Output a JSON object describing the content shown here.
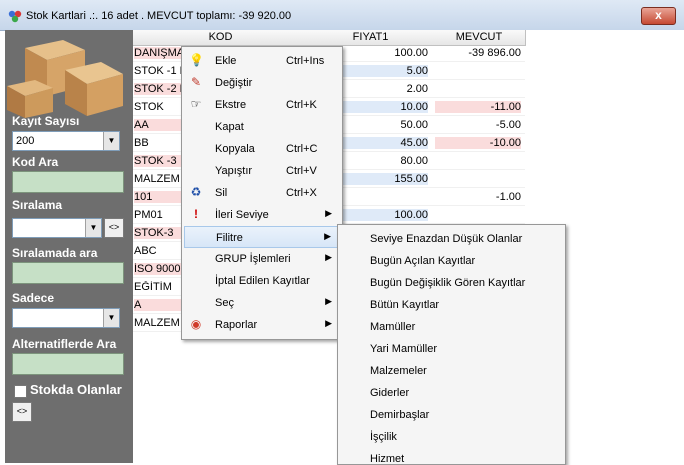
{
  "window": {
    "title": "Stok Kartlari   .:.  16 adet . MEVCUT toplamı: -39 920.00",
    "close_label": "x"
  },
  "left": {
    "kayit_label": "Kayıt Sayısı",
    "kayit_value": "200",
    "kod_ara_label": "Kod Ara",
    "siralama_label": "Sıralama",
    "siralamada_ara_label": "Sıralamada ara",
    "sadece_label": "Sadece",
    "alternatif_label": "Alternatiflerde Ara",
    "stokda_label": "Stokda Olanlar",
    "swap_button": "<>"
  },
  "grid": {
    "columns": [
      "KOD",
      "FIYAT1",
      "MEVCUT"
    ],
    "rows": [
      {
        "kod": "DANIŞMA",
        "fiyat": "100.00",
        "mevcut": "-39 896.00"
      },
      {
        "kod": "STOK -1 D",
        "fiyat": "5.00",
        "mevcut": ""
      },
      {
        "kod": "STOK -2 D",
        "fiyat": "2.00",
        "mevcut": ""
      },
      {
        "kod": "STOK",
        "fiyat": "10.00",
        "mevcut": "-11.00"
      },
      {
        "kod": "AA",
        "fiyat": "50.00",
        "mevcut": "-5.00"
      },
      {
        "kod": "BB",
        "fiyat": "45.00",
        "mevcut": "-10.00"
      },
      {
        "kod": "STOK -3",
        "fiyat": "80.00",
        "mevcut": ""
      },
      {
        "kod": "MALZEM",
        "fiyat": "155.00",
        "mevcut": ""
      },
      {
        "kod": "101",
        "fiyat": "",
        "mevcut": "-1.00"
      },
      {
        "kod": "PM01",
        "fiyat": "100.00",
        "mevcut": ""
      },
      {
        "kod": "STOK-3",
        "fiyat": "",
        "mevcut": ""
      },
      {
        "kod": "ABC",
        "fiyat": "",
        "mevcut": ""
      },
      {
        "kod": "İSO 9000",
        "fiyat": "",
        "mevcut": ""
      },
      {
        "kod": "EĞİTİM",
        "fiyat": "",
        "mevcut": ""
      },
      {
        "kod": "A",
        "fiyat": "",
        "mevcut": ""
      },
      {
        "kod": "MALZEM",
        "fiyat": "",
        "mevcut": ""
      }
    ]
  },
  "context_menu": [
    {
      "label": "Ekle",
      "shortcut": "Ctrl+Ins",
      "icon": "bulb-icon",
      "submenu": false
    },
    {
      "label": "Değiştir",
      "shortcut": "",
      "icon": "pencil-icon",
      "submenu": false
    },
    {
      "label": "Ekstre",
      "shortcut": "Ctrl+K",
      "icon": "hand-icon",
      "submenu": false
    },
    {
      "label": "Kapat",
      "shortcut": "",
      "icon": "",
      "submenu": false
    },
    {
      "label": "Kopyala",
      "shortcut": "Ctrl+C",
      "icon": "",
      "submenu": false
    },
    {
      "label": "Yapıştır",
      "shortcut": "Ctrl+V",
      "icon": "",
      "submenu": false
    },
    {
      "label": "Sil",
      "shortcut": "Ctrl+X",
      "icon": "recycle-icon",
      "submenu": false
    },
    {
      "label": "İleri Seviye",
      "shortcut": "",
      "icon": "exclamation-icon",
      "submenu": true
    },
    {
      "label": "Filitre",
      "shortcut": "",
      "icon": "",
      "submenu": true
    },
    {
      "label": "GRUP İşlemleri",
      "shortcut": "",
      "icon": "",
      "submenu": true
    },
    {
      "label": "İptal Edilen Kayıtlar",
      "shortcut": "",
      "icon": "",
      "submenu": false
    },
    {
      "label": "Seç",
      "shortcut": "",
      "icon": "",
      "submenu": true
    },
    {
      "label": "Raporlar",
      "shortcut": "",
      "icon": "report-icon",
      "submenu": true
    }
  ],
  "filter_submenu": [
    "Seviye Enazdan Düşük Olanlar",
    "Bugün Açılan Kayıtlar",
    "Bugün Değişiklik Gören Kayıtlar",
    "Bütün Kayıtlar",
    "Mamüller",
    "Yari Mamüller",
    "Malzemeler",
    "Giderler",
    "Demirbaşlar",
    "İşçilik",
    "Hizmet"
  ],
  "colors": {
    "pink_row": "#fadcdc",
    "blue_row": "#dfeaf8",
    "green_field": "#c6e0c6",
    "panel": "#6e6e6e"
  }
}
